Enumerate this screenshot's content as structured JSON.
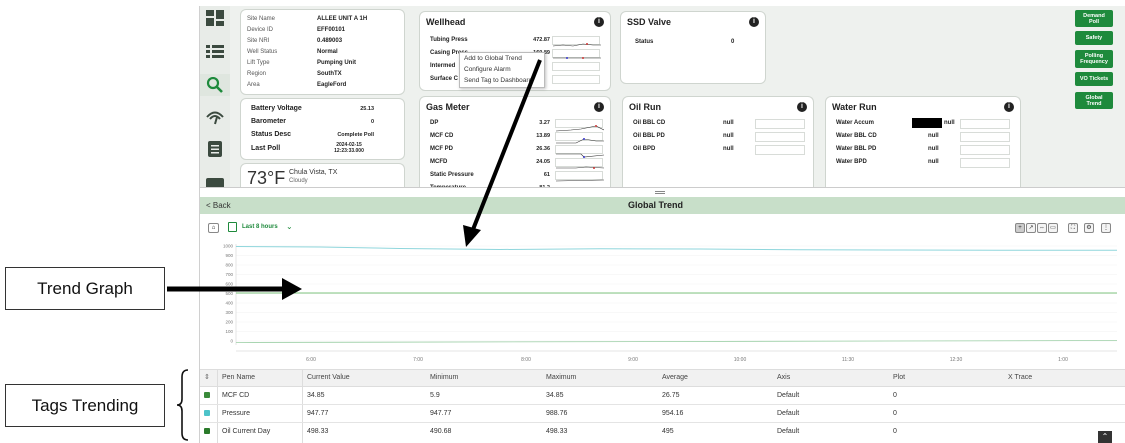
{
  "annotations": {
    "trend_graph": "Trend Graph",
    "tags_trending": "Tags Trending"
  },
  "site": {
    "rows": [
      {
        "label": "Site Name",
        "value": "ALLEE UNIT A 1H"
      },
      {
        "label": "Device ID",
        "value": "EFF00101"
      },
      {
        "label": "Site NRI",
        "value": "0.489003"
      },
      {
        "label": "Well Status",
        "value": "Normal"
      },
      {
        "label": "Lift Type",
        "value": "Pumping Unit"
      },
      {
        "label": "Region",
        "value": "SouthTX"
      },
      {
        "label": "Area",
        "value": "EagleFord"
      }
    ]
  },
  "battery": {
    "rows": [
      {
        "label": "Battery Voltage",
        "value": "25.13"
      },
      {
        "label": "Barometer",
        "value": "0"
      },
      {
        "label": "Status Desc",
        "value": "Complete Poll"
      },
      {
        "label": "Last Poll",
        "value": "2024-02-15 12:23:33.000"
      }
    ]
  },
  "weather": {
    "temp": "73°F",
    "location": "Chula Vista, TX",
    "condition": "Cloudy"
  },
  "wellhead": {
    "title": "Wellhead",
    "rows": [
      {
        "label": "Tubing Press",
        "value": "472.87"
      },
      {
        "label": "Casing Press",
        "value": "160.89"
      },
      {
        "label": "Intermed",
        "value": ""
      },
      {
        "label": "Surface C",
        "value": ""
      }
    ]
  },
  "context_menu": [
    "Add to Global Trend",
    "Configure Alarm",
    "Send Tag to Dashboard"
  ],
  "ssd": {
    "title": "SSD Valve",
    "rows": [
      {
        "label": "Status",
        "value": "0"
      }
    ]
  },
  "gas_meter": {
    "title": "Gas Meter",
    "rows": [
      {
        "label": "DP",
        "value": "3.27"
      },
      {
        "label": "MCF CD",
        "value": "13.89"
      },
      {
        "label": "MCF PD",
        "value": "26.36"
      },
      {
        "label": "MCFD",
        "value": "24.05"
      },
      {
        "label": "Static Pressure",
        "value": "61"
      },
      {
        "label": "Temperature",
        "value": "81.2"
      }
    ]
  },
  "oil_run": {
    "title": "Oil Run",
    "rows": [
      {
        "label": "Oil BBL CD",
        "value": "null"
      },
      {
        "label": "Oil BBL PD",
        "value": "null"
      },
      {
        "label": "Oil BPD",
        "value": "null"
      }
    ]
  },
  "water_run": {
    "title": "Water Run",
    "rows": [
      {
        "label": "Water Accum",
        "value": "null"
      },
      {
        "label": "Water BBL CD",
        "value": "null"
      },
      {
        "label": "Water BBL PD",
        "value": "null"
      },
      {
        "label": "Water BPD",
        "value": "null"
      }
    ]
  },
  "side_buttons": [
    "Demand Poll",
    "Safety",
    "Polling Frequency",
    "VO Tickets",
    "Global Trend"
  ],
  "global_trend": {
    "back": "< Back",
    "title": "Global Trend",
    "range": "Last 8 hours",
    "y_ticks": [
      "1000",
      "900",
      "800",
      "700",
      "600",
      "500",
      "400",
      "300",
      "200",
      "100",
      "0"
    ],
    "x_ticks": [
      "6:00",
      "7:00",
      "8:00",
      "9:00",
      "10:00",
      "11:30",
      "12:30",
      "1:00"
    ]
  },
  "table": {
    "headers": [
      "Pen Name",
      "Current Value",
      "Minimum",
      "Maximum",
      "Average",
      "Axis",
      "Plot",
      "X Trace"
    ],
    "rows": [
      {
        "pen": "MCF CD",
        "current": "34.85",
        "min": "5.9",
        "max": "34.85",
        "avg": "26.75",
        "axis": "Default",
        "plot": "0",
        "color": "#3a8a3a"
      },
      {
        "pen": "Pressure",
        "current": "947.77",
        "min": "947.77",
        "max": "988.76",
        "avg": "954.16",
        "axis": "Default",
        "plot": "0",
        "color": "#4dc3c9"
      },
      {
        "pen": "Oil Current Day",
        "current": "498.33",
        "min": "490.68",
        "max": "498.33",
        "avg": "495",
        "axis": "Default",
        "plot": "0",
        "color": "#2a7a2a"
      }
    ]
  },
  "colors": {
    "accent": "#1e8a3c",
    "trend_cyan": "#8fd6dc",
    "trend_green": "#7fc47f"
  }
}
